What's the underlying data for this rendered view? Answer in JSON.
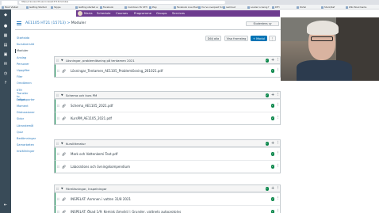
{
  "browser": {
    "address": "https://canvas.kth.se/courses/15713/modules",
    "bookmarks": [
      "Most Visited",
      "Getting Started",
      "Skype",
      "Getting started w",
      "Facebook",
      "Cooldown för KTH",
      "Play",
      "Facebook Live Plackb",
      "You've overpaid for",
      "iveCloud",
      "Loader is being f",
      "KTH",
      "Portal",
      "Stock/Kaf",
      "Wiki Bookmarks"
    ]
  },
  "global_nav": {
    "user": "Maria",
    "items": [
      "Schedule",
      "Courses",
      "Programme",
      "Groups",
      "Services"
    ]
  },
  "breadcrumb": {
    "course": "AE1105 HT21 (15713)",
    "separator": ">",
    "page": "Moduler"
  },
  "student_view_label": "Studentens vy",
  "course_nav": [
    {
      "label": "Startsida",
      "active": false
    },
    {
      "label": "Kursöversikt",
      "active": false
    },
    {
      "label": "Moduler",
      "active": true
    },
    {
      "label": "Anslag",
      "active": false
    },
    {
      "label": "Personer",
      "active": false
    },
    {
      "label": "Uppgifter",
      "active": false
    },
    {
      "label": "Filer",
      "active": false
    },
    {
      "label": "Omdömen",
      "active": false
    },
    {
      "label": "KTH Transfer to Ladok",
      "active": false
    },
    {
      "label": "Frågesporter",
      "active": false
    },
    {
      "label": "Moment",
      "active": false
    },
    {
      "label": "Diskussioner",
      "active": false
    },
    {
      "label": "Sidor",
      "active": false
    },
    {
      "label": "Lärandemål",
      "active": false
    },
    {
      "label": "Quiz",
      "active": false
    },
    {
      "label": "Bedömningar",
      "active": false
    },
    {
      "label": "Samarbeten",
      "active": false
    },
    {
      "label": "Inställningar",
      "active": false
    }
  ],
  "actions": {
    "collapse_all": "Dölj alla",
    "progress": "Visa framsteg",
    "add_module": "+ Modul"
  },
  "modules": [
    {
      "title": "Lösningar, problemlösning på tentamen 2021",
      "items": [
        {
          "title": "Lösningar_Tentamen_AE1105_Problemlösning_261021.pdf"
        }
      ]
    },
    {
      "title": "Schema och kurs PM",
      "items": [
        {
          "title": "Schema_AE1105_2021.pdf"
        },
        {
          "title": "KursPM_AE1105_2021.pdf"
        }
      ]
    },
    {
      "title": "Kurslitteratur",
      "items": [
        {
          "title": "Mark och Vattenkemi Text.pdf"
        },
        {
          "title": "Laborations och övningskompendium"
        }
      ]
    },
    {
      "title": "Föreläsningar, Inspelningar",
      "items": [
        {
          "title": "INSPELAT: Anmnen i vatten 31/8 2021"
        },
        {
          "title": "INSPELAT: Ökad 1/9: Kemisk jämvikt I: Grunder, vattnets autoprotolys"
        }
      ]
    }
  ],
  "icons": {
    "drag": "drag-handle-icon",
    "caret": "caret-down-icon",
    "published": "check-circle-icon",
    "add": "plus-icon",
    "menu": "kebab-menu-icon",
    "attachment": "paperclip-icon"
  },
  "colors": {
    "global_nav": "#6d3b8f",
    "left_nav": "#394b58",
    "link": "#2b7abc",
    "primary_button": "#0374b5",
    "published": "#0b874b"
  }
}
